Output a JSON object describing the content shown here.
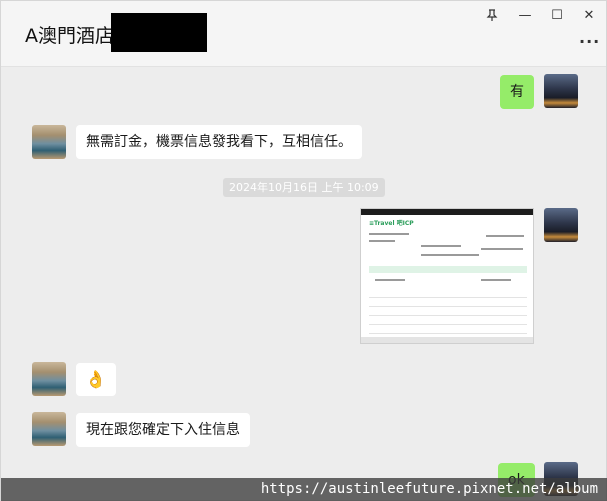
{
  "window": {
    "title": "A澳門酒店",
    "controls": {
      "pin_icon": "pin-icon",
      "minimize_glyph": "—",
      "maximize_glyph": "☐",
      "close_glyph": "✕",
      "more_glyph": "···"
    }
  },
  "messages": [
    {
      "side": "right",
      "type": "text",
      "text": "有"
    },
    {
      "side": "left",
      "type": "text",
      "text": "無需訂金，機票信息發我看下，互相信任。"
    },
    {
      "type": "timestamp",
      "text": "2024年10月16日 上午 10:09"
    },
    {
      "side": "right",
      "type": "image",
      "caption": "Trip ticket screenshot",
      "logo_text": "≡Travel 吧ICP"
    },
    {
      "side": "left",
      "type": "emoji",
      "emoji": "👌"
    },
    {
      "side": "left",
      "type": "text",
      "text": "現在跟您確定下入住信息"
    },
    {
      "side": "right",
      "type": "text",
      "text": "ok"
    }
  ],
  "watermark": "https://austinleefuture.pixnet.net/album"
}
